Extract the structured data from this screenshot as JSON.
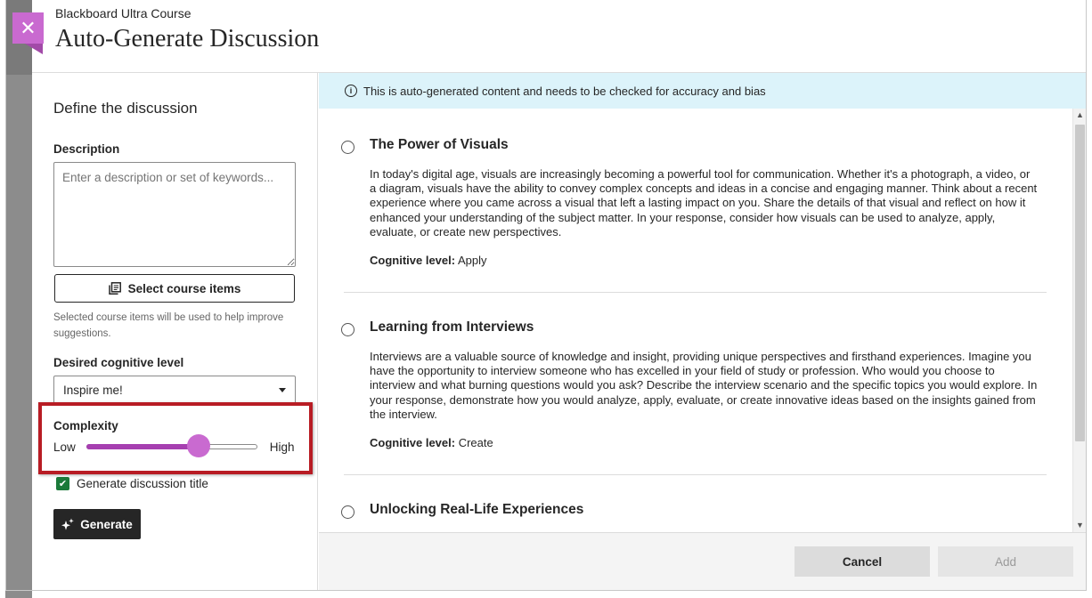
{
  "header": {
    "breadcrumb": "Blackboard Ultra Course",
    "title": "Auto-Generate Discussion",
    "close_glyph": "✕"
  },
  "left": {
    "heading": "Define the discussion",
    "description_label": "Description",
    "description_placeholder": "Enter a description or set of keywords...",
    "select_items_label": "Select course items",
    "help_text": "Selected course items will be used to help improve suggestions.",
    "cognitive_label": "Desired cognitive level",
    "cognitive_value": "Inspire me!",
    "complexity_label": "Complexity",
    "slider_low": "Low",
    "slider_high": "High",
    "slider_level": 0.66,
    "checkbox_label": "Generate discussion title",
    "checkbox_checked": true,
    "generate_label": "Generate"
  },
  "notice": {
    "text": "This is auto-generated content and needs to be checked for accuracy and bias",
    "icon": "info-icon"
  },
  "results": [
    {
      "title": "The Power of Visuals",
      "body": "In today's digital age, visuals are increasingly becoming a powerful tool for communication. Whether it's a photograph, a video, or a diagram, visuals have the ability to convey complex concepts and ideas in a concise and engaging manner. Think about a recent experience where you came across a visual that left a lasting impact on you. Share the details of that visual and reflect on how it enhanced your understanding of the subject matter. In your response, consider how visuals can be used to analyze, apply, evaluate, or create new perspectives.",
      "meta_label": "Cognitive level:",
      "meta_value": "Apply"
    },
    {
      "title": "Learning from Interviews",
      "body": "Interviews are a valuable source of knowledge and insight, providing unique perspectives and firsthand experiences. Imagine you have the opportunity to interview someone who has excelled in your field of study or profession. Who would you choose to interview and what burning questions would you ask? Describe the interview scenario and the specific topics you would explore. In your response, demonstrate how you would analyze, apply, evaluate, or create innovative ideas based on the insights gained from the interview.",
      "meta_label": "Cognitive level:",
      "meta_value": "Create"
    },
    {
      "title": "Unlocking Real-Life Experiences"
    }
  ],
  "footer": {
    "cancel_label": "Cancel",
    "add_label": "Add"
  },
  "colors": {
    "accent": "#c96ad0",
    "slider_fill": "#a63fb0",
    "highlight": "#b81c24",
    "checkbox": "#1b7a3a",
    "notice_bg": "#dcf3fa"
  }
}
